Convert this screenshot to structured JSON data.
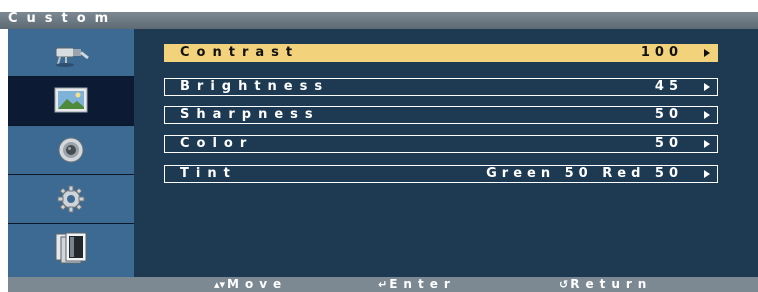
{
  "title": "Custom",
  "menu": {
    "tabs": [
      {
        "icon": "input-plug-icon"
      },
      {
        "icon": "picture-icon",
        "active": true
      },
      {
        "icon": "speaker-icon"
      },
      {
        "icon": "settings-gear-icon"
      },
      {
        "icon": "multi-screen-icon"
      }
    ],
    "items": [
      {
        "label": "Contrast",
        "value": "100",
        "selected": true
      },
      {
        "label": "Brightness",
        "value": "45"
      },
      {
        "label": "Sharpness",
        "value": "50"
      },
      {
        "label": "Color",
        "value": "50"
      },
      {
        "label": "Tint",
        "value": "Green 50 Red 50"
      }
    ]
  },
  "hints": {
    "move": {
      "icon": "up-down-arrows-icon",
      "label": "Move"
    },
    "enter": {
      "icon": "enter-icon",
      "label": "Enter"
    },
    "return": {
      "icon": "return-icon",
      "label": "Return"
    }
  },
  "colors": {
    "background": "#1d3a52",
    "sidebar": "#3d6a92",
    "selected": "#f2d27a",
    "bars": "#7c8993"
  }
}
